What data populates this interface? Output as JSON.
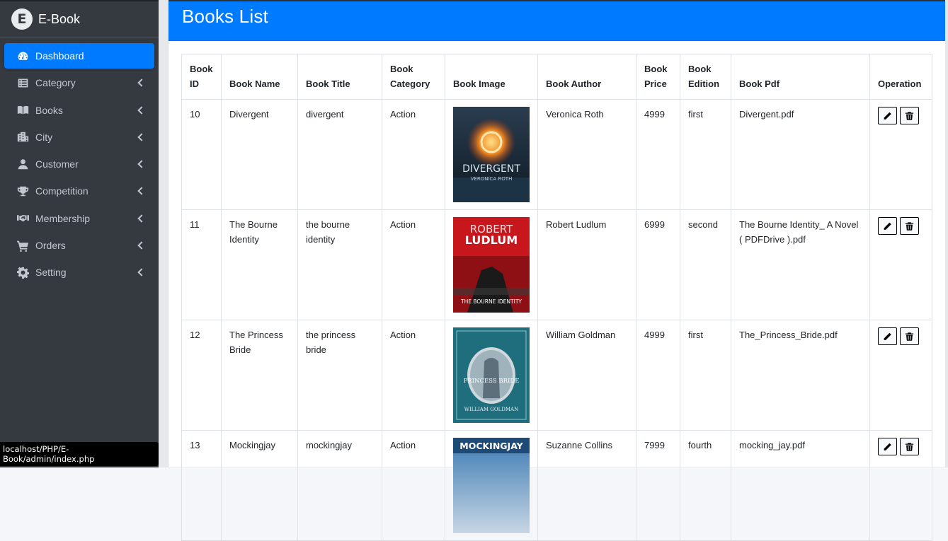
{
  "brand": {
    "logo_letter": "E",
    "name": "E-Book"
  },
  "sidebar": {
    "items": [
      {
        "label": "Dashboard",
        "icon": "dashboard-icon",
        "active": true
      },
      {
        "label": "Category",
        "icon": "list-icon"
      },
      {
        "label": "Books",
        "icon": "book-icon"
      },
      {
        "label": "City",
        "icon": "building-icon"
      },
      {
        "label": "Customer",
        "icon": "user-icon"
      },
      {
        "label": "Competition",
        "icon": "trophy-icon"
      },
      {
        "label": "Membership",
        "icon": "handshake-icon"
      },
      {
        "label": "Orders",
        "icon": "cart-icon"
      },
      {
        "label": "Setting",
        "icon": "gear-icon"
      }
    ]
  },
  "status_bar_url": "localhost/PHP/E-Book/admin/index.php",
  "card": {
    "title": "Books List"
  },
  "table": {
    "headers": [
      "Book ID",
      "Book Name",
      "Book Title",
      "Book Category",
      "Book Image",
      "Book Author",
      "Book Price",
      "Book Edition",
      "Book Pdf",
      "Operation"
    ],
    "rows": [
      {
        "id": "10",
        "name": "Divergent",
        "title": "divergent",
        "category": "Action",
        "cover": {
          "top_text": "",
          "main_text": "DIVERGENT",
          "sub_text": "VERONICA ROTH",
          "colors": [
            "#1b2a38",
            "#e8772e"
          ]
        },
        "author": "Veronica Roth",
        "price": "4999",
        "edition": "first",
        "pdf": "Divergent.pdf"
      },
      {
        "id": "11",
        "name": "The Bourne Identity",
        "title": "the bourne identity",
        "category": "Action",
        "cover": {
          "top_text": "ROBERT",
          "main_text": "LUDLUM",
          "sub_text": "THE BOURNE IDENTITY",
          "colors": [
            "#c8161d",
            "#1a1a1a"
          ]
        },
        "author": "Robert Ludlum",
        "price": "6999",
        "edition": "second",
        "pdf": "The Bourne Identity_ A Novel ( PDFDrive ).pdf"
      },
      {
        "id": "12",
        "name": "The Princess Bride",
        "title": "the princess bride",
        "category": "Action",
        "cover": {
          "top_text": "",
          "main_text": "PRINCESS BRIDE",
          "sub_text": "WILLIAM GOLDMAN",
          "colors": [
            "#1f6e7d",
            "#d9dde0"
          ]
        },
        "author": "William Goldman",
        "price": "4999",
        "edition": "first",
        "pdf": "The_Princess_Bride.pdf"
      },
      {
        "id": "13",
        "name": "Mockingjay",
        "title": "mockingjay",
        "category": "Action",
        "cover": {
          "top_text": "",
          "main_text": "MOCKINGJAY",
          "sub_text": "",
          "colors": [
            "#2f6fa8",
            "#c7d6e4"
          ]
        },
        "author": "Suzanne Collins",
        "price": "7999",
        "edition": "fourth",
        "pdf": "mocking_jay.pdf"
      }
    ]
  }
}
